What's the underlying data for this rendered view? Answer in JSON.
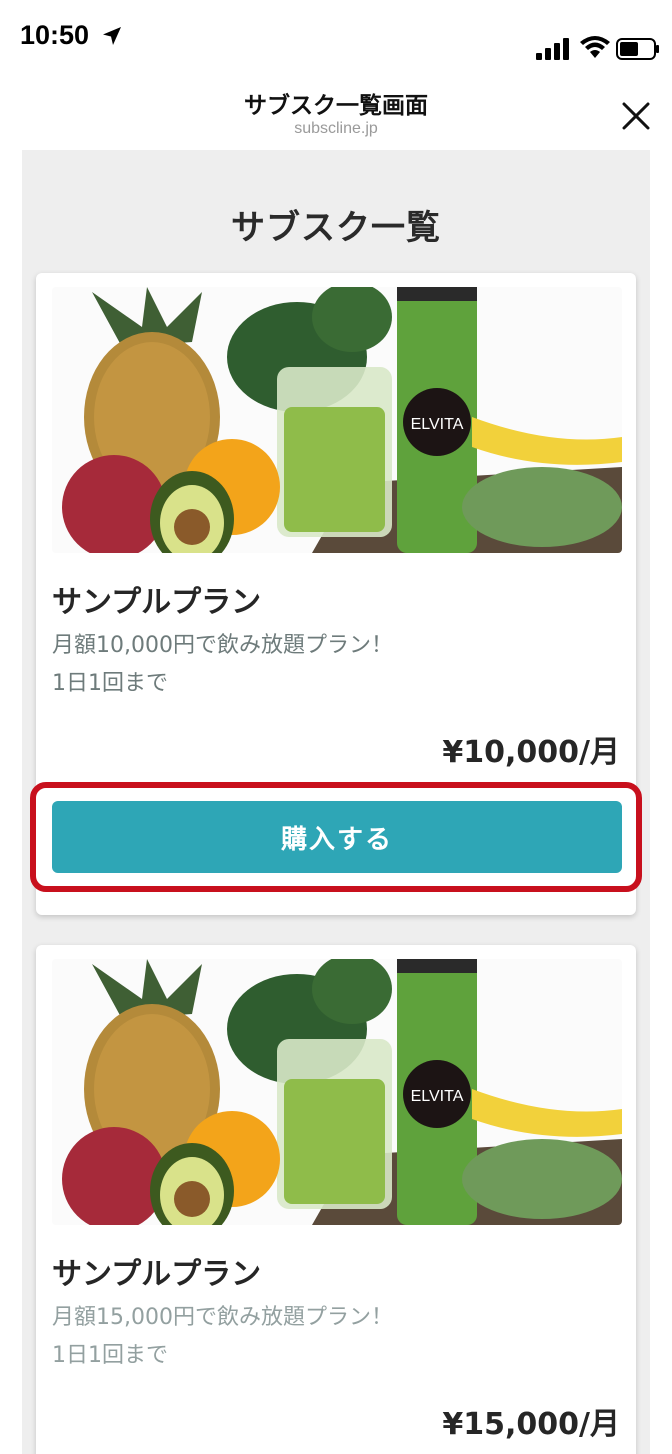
{
  "status_bar": {
    "time": "10:50",
    "icons": [
      "location-arrow-icon",
      "signal-icon",
      "wifi-icon",
      "battery-icon"
    ]
  },
  "nav": {
    "title": "サブスク一覧画面",
    "url": "subscline.jp",
    "close_icon": "close-icon"
  },
  "page": {
    "heading": "サブスク一覧"
  },
  "plans": [
    {
      "image_label": "ELVITA",
      "title": "サンプルプラン",
      "desc_line1": "月額10,000円で飲み放題プラン！",
      "desc_line2": "1日1回まで",
      "price": "¥10,000/月",
      "button_label": "購入する"
    },
    {
      "image_label": "ELVITA",
      "title": "サンプルプラン",
      "desc_line1": "月額15,000円で飲み放題プラン！",
      "desc_line2": "1日1回まで",
      "price": "¥15,000/月"
    }
  ],
  "colors": {
    "button": "#2ea6b6",
    "highlight": "#c8101d",
    "background": "#eeeeee"
  }
}
